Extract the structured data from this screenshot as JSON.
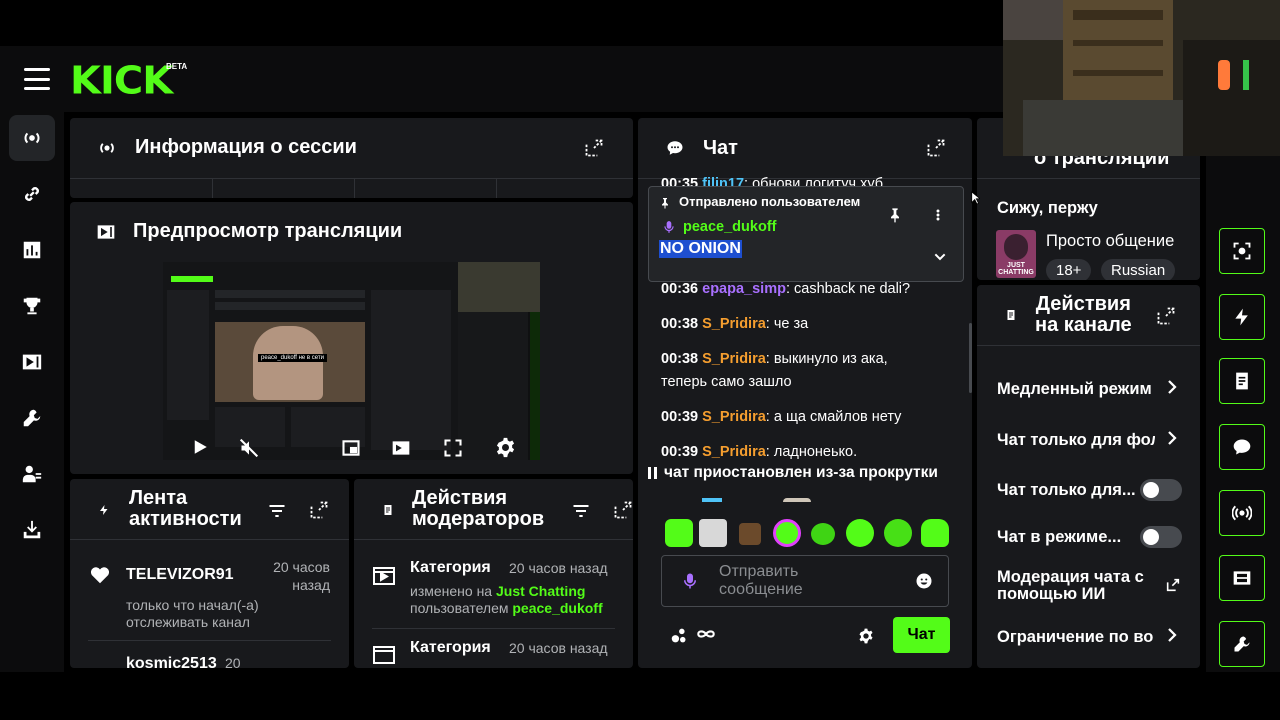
{
  "brand": {
    "logo": "KICK",
    "beta": "BETA"
  },
  "sidebar": {
    "items": [
      {
        "name": "broadcast-icon"
      },
      {
        "name": "link-icon"
      },
      {
        "name": "chart-icon"
      },
      {
        "name": "trophy-icon"
      },
      {
        "name": "video-icon"
      },
      {
        "name": "wrench-icon"
      },
      {
        "name": "users-icon"
      },
      {
        "name": "download-icon"
      }
    ]
  },
  "session": {
    "title": "Информация о сессии"
  },
  "preview": {
    "title": "Предпросмотр трансляции",
    "inner_label": "peace_dukoff не в сети"
  },
  "activity": {
    "title_line1": "Лента",
    "title_line2": "активности",
    "items": [
      {
        "user": "TELEVIZOR91",
        "time_line1": "20 часов",
        "time_line2": "назад",
        "text_line1": "только что начал(-а)",
        "text_line2": "отслеживать канал"
      },
      {
        "user": "kosmic2513",
        "time_line1": "20",
        "time_line2": ""
      }
    ]
  },
  "modactions": {
    "title_line1": "Действия",
    "title_line2": "модераторов",
    "items": [
      {
        "label": "Категория",
        "time": "20 часов назад",
        "line2_prefix": "изменено на ",
        "line2_value": "Just Chatting",
        "line3_prefix": "пользователем ",
        "line3_value": "peace_dukoff"
      },
      {
        "label": "Категория",
        "time": "20 часов назад"
      }
    ]
  },
  "chat": {
    "title": "Чат",
    "top_line": {
      "time": "00:35",
      "user": "filin17",
      "msg": ": обнови логитуч хуб"
    },
    "pinned": {
      "header": "Отправлено пользователем",
      "user": "peace_dukoff",
      "message": "NO ONION"
    },
    "messages": [
      {
        "time": "00:36",
        "user": "epapa_simp",
        "color": "#a970ff",
        "msg": ": cashback ne dali?"
      },
      {
        "time": "00:38",
        "user": "S_Pridira",
        "color": "#f59e2f",
        "msg": ": че за"
      },
      {
        "time": "00:38",
        "user": "S_Pridira",
        "color": "#f59e2f",
        "msg": ": выкинуло из ака,",
        "msg2": "теперь само зашло"
      },
      {
        "time": "00:39",
        "user": "S_Pridira",
        "color": "#f59e2f",
        "msg": ": а ща смайлов нету"
      },
      {
        "time": "00:39",
        "user": "S_Pridira",
        "color": "#f59e2f",
        "msg": ": ладнонеько."
      }
    ],
    "paused": "чат приостановлен из-за прокрутки",
    "input_placeholder_line1": "Отправить",
    "input_placeholder_line2": "сообщение",
    "send_label": "Чат"
  },
  "stream_info": {
    "title": "о трансляции",
    "stream_title": "Сижу, пержу",
    "category": "Просто общение",
    "thumb_label_line1": "JUST",
    "thumb_label_line2": "CHATTING",
    "tags": [
      "18+",
      "Russian"
    ]
  },
  "channel_actions": {
    "title_line1": "Действия",
    "title_line2": "на канале",
    "rows": [
      {
        "label": "Медленный режим",
        "type": "chevron"
      },
      {
        "label": "Чат только для фол",
        "type": "chevron"
      },
      {
        "label": "Чат только для...",
        "type": "toggle",
        "state": "off"
      },
      {
        "label": "Чат в режиме...",
        "type": "toggle",
        "state": "off"
      },
      {
        "label_line1": "Модерация чата с",
        "label_line2": "помощью ИИ",
        "type": "external"
      },
      {
        "label": "Ограничение по во",
        "type": "chevron"
      }
    ]
  },
  "colors": {
    "accent": "#53fc18",
    "panel": "#18191c",
    "bg": "#000000"
  }
}
